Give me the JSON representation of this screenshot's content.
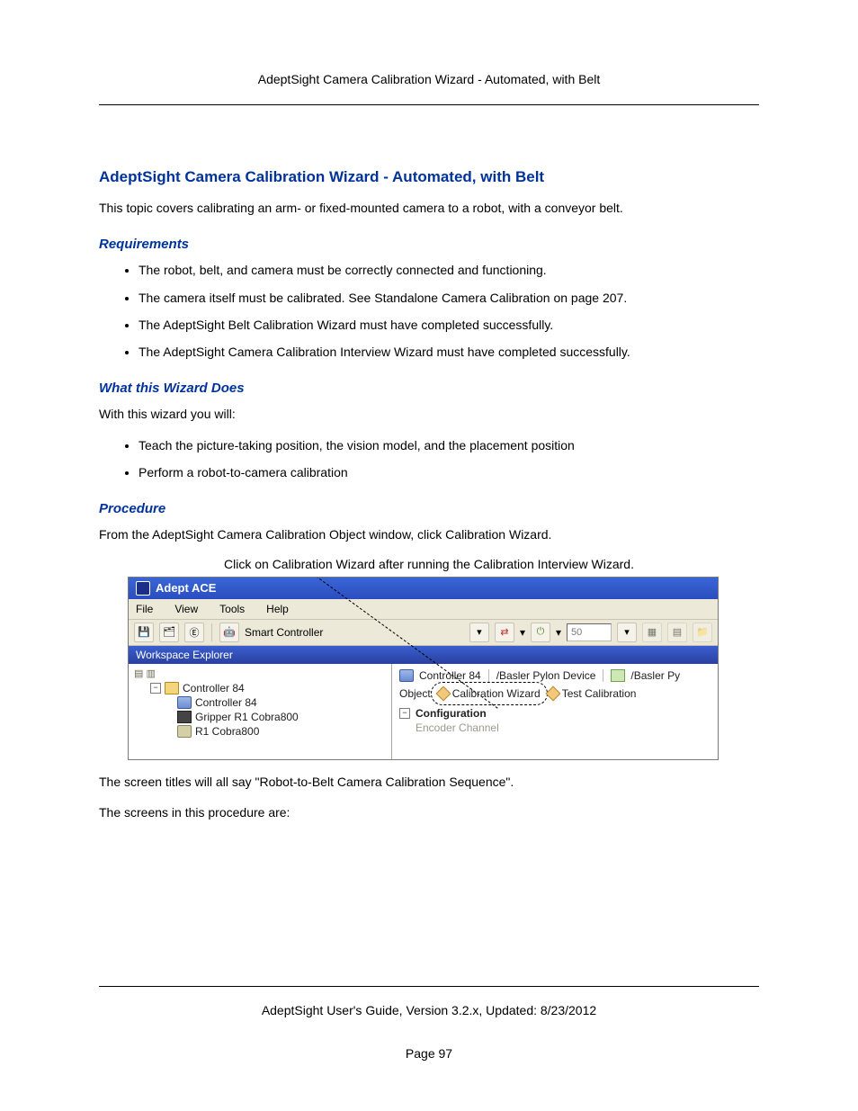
{
  "header": {
    "running_title": "AdeptSight Camera Calibration Wizard - Automated, with Belt"
  },
  "title": "AdeptSight Camera Calibration Wizard - Automated, with Belt",
  "intro": "This topic covers calibrating an arm- or fixed-mounted camera to a robot, with a conveyor belt.",
  "sections": {
    "requirements": {
      "heading": "Requirements",
      "items": [
        "The robot, belt, and camera must be correctly connected and functioning.",
        "The camera itself must be calibrated. See Standalone Camera Calibration on page 207.",
        "The AdeptSight Belt Calibration Wizard must have completed successfully.",
        "The AdeptSight Camera Calibration Interview Wizard must have completed successfully."
      ]
    },
    "what": {
      "heading": "What this Wizard Does",
      "lead": "With this wizard you will:",
      "items": [
        "Teach the picture-taking position, the vision model, and the placement position",
        "Perform a robot-to-camera calibration"
      ]
    },
    "procedure": {
      "heading": "Procedure",
      "lead": "From the AdeptSight Camera Calibration Object window, click Calibration Wizard.",
      "caption": "Click on Calibration Wizard after running the Calibration Interview Wizard.",
      "after1": "The screen titles will all say \"Robot-to-Belt Camera Calibration Sequence\".",
      "after2": "The screens in this procedure are:"
    }
  },
  "screenshot": {
    "app_title": "Adept ACE",
    "menus": {
      "file": "File",
      "view": "View",
      "tools": "Tools",
      "help": "Help"
    },
    "toolbar": {
      "controller_label": "Smart Controller",
      "speed_value": "50"
    },
    "panel_title": "Workspace Explorer",
    "tree": {
      "root": "Controller 84",
      "child_ctrl": "Controller 84",
      "child_gripper": "Gripper R1 Cobra800",
      "child_robot": "R1 Cobra800"
    },
    "breadcrumb": {
      "a": "Controller 84",
      "b": "/Basler Pylon Device",
      "c": "/Basler Py"
    },
    "object_row": {
      "label": "Object",
      "wizard": "Calibration Wizard",
      "test": "Test Calibration"
    },
    "config": {
      "title": "Configuration",
      "sub": "Encoder Channel"
    }
  },
  "footer": {
    "guide": "AdeptSight User's Guide,  Version 3.2.x, Updated: 8/23/2012",
    "page": "Page 97"
  }
}
